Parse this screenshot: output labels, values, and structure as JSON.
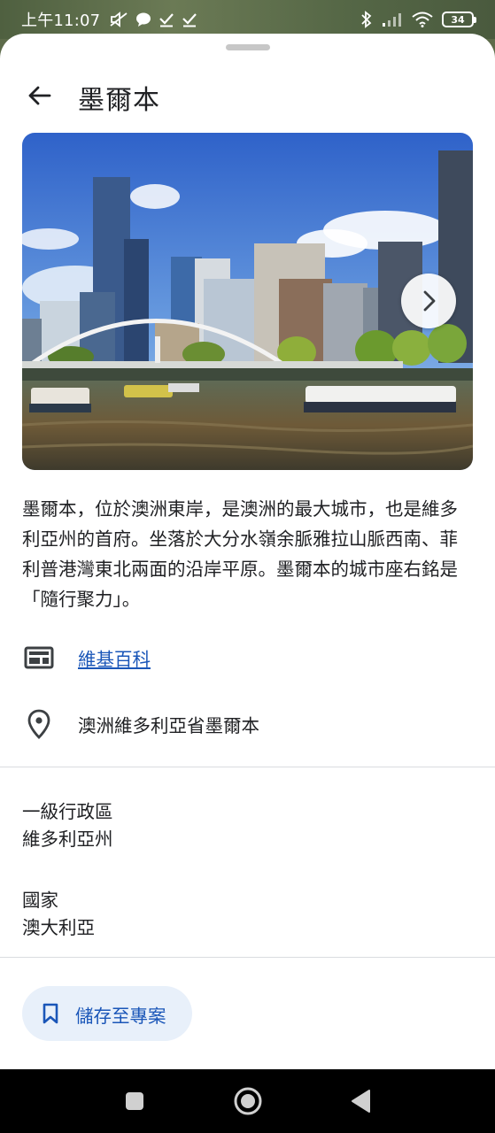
{
  "status_bar": {
    "time": "上午11:07",
    "battery": "34",
    "icons_left": [
      "mute-icon",
      "chat-bubble-icon",
      "check-icon",
      "check-icon"
    ],
    "icons_right": [
      "bluetooth-icon",
      "signal-icon",
      "wifi-icon",
      "battery-icon"
    ]
  },
  "header": {
    "title": "墨爾本",
    "back_icon": "arrow-left-icon"
  },
  "hero": {
    "next_icon": "chevron-right-icon"
  },
  "description": "墨爾本，位於澳洲東岸，是澳洲的最大城市，也是維多利亞州的首府。坐落於大分水嶺余脈雅拉山脈西南、菲利普港灣東北兩面的沿岸平原。墨爾本的城市座右銘是「隨行聚力」。",
  "links": {
    "wiki": {
      "icon": "article-icon",
      "label": "維基百科"
    },
    "address": {
      "icon": "location-pin-icon",
      "label": "澳洲維多利亞省墨爾本"
    }
  },
  "attributes": [
    {
      "label": "一級行政區",
      "value": "維多利亞州"
    },
    {
      "label": "國家",
      "value": "澳大利亞"
    }
  ],
  "save_button": {
    "icon": "bookmark-icon",
    "label": "儲存至專案"
  },
  "nav_bar": {
    "icons": [
      "recents-square-icon",
      "home-circle-icon",
      "back-triangle-icon"
    ]
  },
  "colors": {
    "link": "#1a56b8",
    "save_button_bg": "#e8f0fa",
    "nav_bar": "#000000"
  }
}
